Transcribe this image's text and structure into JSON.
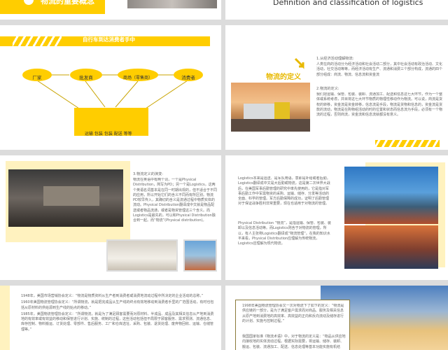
{
  "slide1": {
    "title_left": "物流的重要概念",
    "title_right": "Definition and classification of logistics"
  },
  "slide2": {
    "banner": "自行车到达消费者手中",
    "nodes": [
      "厂家",
      "批发商",
      "商场（零售商）",
      "消费者"
    ],
    "box_text": "运输 包装 包装 配送 等等"
  },
  "slide3": {
    "heading": "物流的定义",
    "p1_title": "1.从经济活动理解物流:",
    "p1_body": "人类在商的活动分为经济活动和社会活动二部分，其中社会活动有政治活动、文化活动，社交活动等等，而经济活动有生产、流通和消费三个部分构成，流通的四个部分组成：商流、物流、信息流和资金流",
    "p2_title": "2.物流的定义:",
    "p2_body": "我们把运输、保管、包装、装卸、流通加工、配送和信息这七大环节，作为一个整体或系统考虑，并目将这七大环节物质的物理性移动作为物流。可以说，商流是货权的转移，资金流是资金转移，信息流是手段，物流是货物和信息的，资金流是货款的流动，物流是在购物组活动的时的位置和状态而信息流为手段，必须有一个物流的过程，否则商流，资金流和信息流就都没有意义。"
  },
  "slide4": {
    "p3_title": "3.物流定义的演变:",
    "p3_body": "物流在英语中有两个词，一个是Physical Distribution，简写为PD；另一个是Logistics。这两个英语名词基本是在同一时期出现的，但不适合于不同的应用，所以开始它们的含义不同而有所区别。物流PD较早传入，其确切的含义是流通过程中物质实体的流动。Physical Distribution翻译成中文就是物品配送或者物品流通，或者是物资管理这三个含义。而Logistics是最先的，可以和Physical Distribution融合到一起。而“物流”(Physical distribution)。"
  },
  "slide5": {
    "b1": "Logistics本来是运送、是军队用语，意即是补给或者后勤。Logistics翻译成中文是大后勤或物流，这是第二次世界大战后，在美国军事后勤管理的研究中率先使用的，它是指对军事后勤工作中军需物资的采购、运输、储存、分发等活动的全面、科学的管理。军方后勤保障的成功，证明了后勤管理对于保证战争胜利非常重要，现在也适用于对物流的管理。",
    "b2": "Physical Distribution “物流”，是指运输、保管、包装、装卸以及信息活动等。而Logistics则含于对物流的管理，所以，有人主张称Logistics翻译成“物流管理”。在我的知识水平来看，Physical Distribution应理解为传统物流，Logistics应理解为现代物流。"
  },
  "slide6": {
    "items": [
      "1948年，美国市场营销协会定义：“物流是物质资料从生产者到消费者或消费地流动过程中所决定的企业活动的总称。”",
      "1960年美国物流管理协会定义：“所谓物流，就是把完成品从生产线的终点有效地移动到消费者手里的广范围活动，有时也包括从原材料的供给源到生产线的始点的移动。”",
      "1985年，美国物流管理协会定义：“所谓物流，就是为了满足顾客需要而对原材料、半成品、成品及其相关信息从产地到消费地的有效率或有效益的移动和保管进行计划、实施、统制的过程，这些活动包括但不局限于顾客服务、需求预测、流通信息、库存控制、物料搬运、订货处理、零部件、售后服务、工厂和仓库选址、采购、包装、退货处理、废弃物回收、运输、仓储管理等。”"
    ]
  },
  "slide7": {
    "items": [
      "1998年美国物流管理协会又一次对物流下了如下的定义：“物流是供应链的一部分，是为了满足客户需求而对商品、服务及相关信息从原产地到消费地的高效率、高效益的正向和反向流动及储存进行的计划、实施与控制过程。”",
      "我国国家标准《物流术语》中，对于物流的定义是：“物品从供应地向接收地的实体流动过程。根据实际需要，将运输、储存、装卸、搬运、包装、流通加工、配送、信息处理等基本功能实施有机结合。”"
    ]
  },
  "colors": {
    "accent": "#ffcd00",
    "text": "#555555",
    "border": "#8a7a3a"
  }
}
